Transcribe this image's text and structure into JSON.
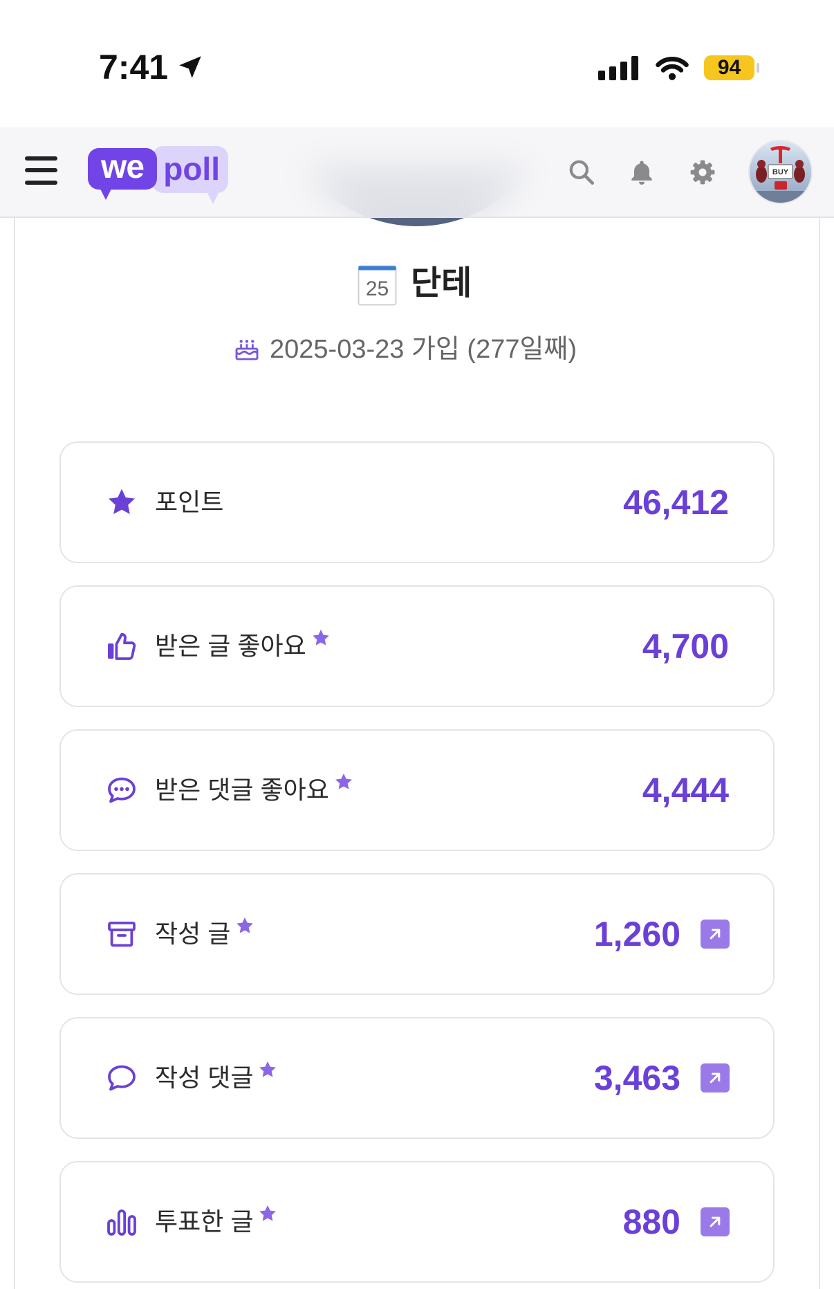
{
  "status_bar": {
    "time": "7:41",
    "battery": "94",
    "icons": [
      "location-arrow-icon",
      "cellular-signal-icon",
      "wifi-icon",
      "battery-icon"
    ]
  },
  "header": {
    "logo_we": "we",
    "logo_poll": "poll",
    "icons": [
      "menu-icon",
      "search-icon",
      "bell-icon",
      "gear-icon"
    ],
    "avatar_sign": "BUY"
  },
  "profile": {
    "calendar_day": "25",
    "name": "단테",
    "joined": "2025-03-23 가입 (277일째)"
  },
  "stats": [
    {
      "icon": "star-icon",
      "label": "포인트",
      "value": "46,412"
    },
    {
      "icon": "thumbs-up-icon",
      "label": "받은 글 좋아요",
      "value": "4,700"
    },
    {
      "icon": "comment-dots-icon",
      "label": "받은 댓글 좋아요",
      "value": "4,444"
    },
    {
      "icon": "archive-icon",
      "label": "작성 글",
      "value": "1,260"
    },
    {
      "icon": "comment-icon",
      "label": "작성 댓글",
      "value": "3,463"
    },
    {
      "icon": "bar-chart-icon",
      "label": "투표한 글",
      "value": "880"
    }
  ],
  "colors": {
    "accent": "#6a40d6",
    "logo_primary": "#7044e6",
    "logo_secondary": "#ddd4fc",
    "star_marker": "#8b66e6",
    "link_box": "#9a7ae8",
    "battery": "#f6c61f",
    "header_icons": "#8a8a8a"
  }
}
